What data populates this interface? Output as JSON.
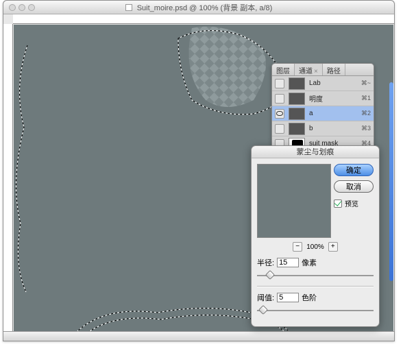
{
  "window": {
    "title": "Suit_moire.psd @ 100% (背景 副本, a/8)"
  },
  "channels_panel": {
    "tabs": [
      "图层",
      "通道",
      "路径"
    ],
    "active_tab_index": 1,
    "items": [
      {
        "label": "Lab",
        "shortcut": "⌘~",
        "eye": false,
        "thumb": "dark"
      },
      {
        "label": "明度",
        "shortcut": "⌘1",
        "eye": false,
        "thumb": "dark"
      },
      {
        "label": "a",
        "shortcut": "⌘2",
        "eye": true,
        "thumb": "dark",
        "selected": true
      },
      {
        "label": "b",
        "shortcut": "⌘3",
        "eye": false,
        "thumb": "dark"
      },
      {
        "label": "suit mask",
        "shortcut": "⌘4",
        "eye": false,
        "thumb": "mask"
      }
    ]
  },
  "dialog": {
    "title": "蒙尘与划痕",
    "ok_label": "确定",
    "cancel_label": "取消",
    "preview_label": "预览",
    "preview_checked": true,
    "zoom_value": "100%",
    "radius_label": "半径:",
    "radius_value": "15",
    "radius_unit": "像素",
    "threshold_label": "阈值:",
    "threshold_value": "5",
    "threshold_unit": "色阶"
  }
}
